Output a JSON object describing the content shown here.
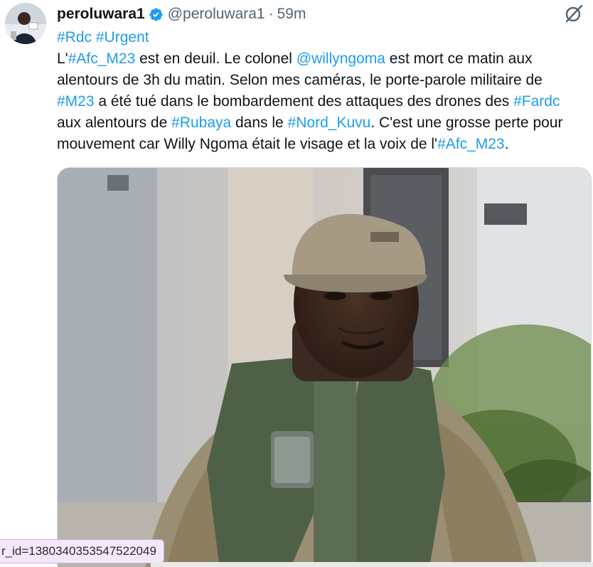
{
  "author": {
    "display_name": "peroluwara1",
    "handle": "@peroluwara1",
    "separator": "·",
    "time_ago": "59m",
    "verified_icon": "verified-badge-icon"
  },
  "tweet": {
    "line1": [
      {
        "text": "#Rdc",
        "type": "tag"
      },
      {
        "text": " ",
        "type": "plain"
      },
      {
        "text": "#Urgent",
        "type": "tag"
      }
    ],
    "line2": [
      {
        "text": "L'",
        "type": "plain"
      },
      {
        "text": "#Afc_M23",
        "type": "tag"
      },
      {
        "text": " est en deuil. Le colonel ",
        "type": "plain"
      },
      {
        "text": "@willyngoma",
        "type": "mention"
      },
      {
        "text": " est mort ce matin aux",
        "type": "plain"
      }
    ],
    "line3": [
      {
        "text": "alentours de 3h du matin. Selon mes caméras,  le porte-parole militaire de",
        "type": "plain"
      }
    ],
    "line4": [
      {
        "text": "#M23",
        "type": "tag"
      },
      {
        "text": " a été tué dans le bombardement des attaques des drones des ",
        "type": "plain"
      },
      {
        "text": "#Fardc",
        "type": "tag"
      }
    ],
    "line5": [
      {
        "text": "aux alentours de ",
        "type": "plain"
      },
      {
        "text": "#Rubaya",
        "type": "tag"
      },
      {
        "text": " dans le ",
        "type": "plain"
      },
      {
        "text": "#Nord_Kuvu",
        "type": "tag"
      },
      {
        "text": ". C'est une grosse perte pour",
        "type": "plain"
      }
    ],
    "line6": [
      {
        "text": "mouvement car Willy Ngoma était le visage et la voix de l'",
        "type": "plain"
      },
      {
        "text": "#Afc_M23",
        "type": "tag"
      },
      {
        "text": ".",
        "type": "plain"
      }
    ]
  },
  "status_bar": {
    "url_fragment": "r_id=1380340353547522049"
  },
  "colors": {
    "link": "#1d9bf0",
    "text": "#0f1419",
    "muted": "#536471",
    "verified": "#1d9bf0"
  },
  "icons": {
    "more": "grok-slash-icon"
  }
}
